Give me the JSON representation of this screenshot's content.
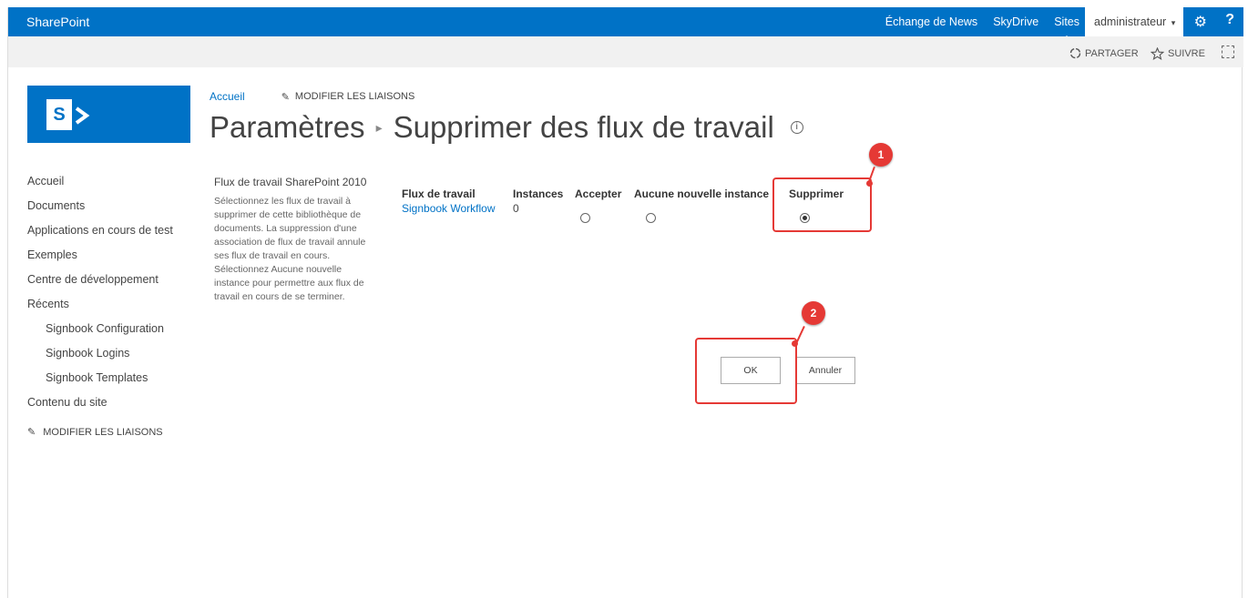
{
  "suitebar": {
    "brand": "SharePoint",
    "links": [
      "Échange de News",
      "SkyDrive",
      "Sites"
    ],
    "user": "administrateur",
    "help": "?",
    "accent": "#0072c6"
  },
  "ribbon": {
    "share": "PARTAGER",
    "follow": "SUIVRE"
  },
  "logo": {
    "letter": "S"
  },
  "topnav": {
    "home": "Accueil",
    "edit_links": "MODIFIER LES LIAISONS"
  },
  "title": {
    "parent": "Paramètres",
    "current": "Supprimer des flux de travail"
  },
  "leftnav": {
    "items": [
      "Accueil",
      "Documents",
      "Applications en cours de test",
      "Exemples",
      "Centre de développement",
      "Récents",
      "Signbook Configuration",
      "Signbook Logins",
      "Signbook Templates",
      "Contenu du site"
    ],
    "edit_links": "MODIFIER LES LIAISONS"
  },
  "section": {
    "title": "Flux de travail SharePoint 2010",
    "description": "Sélectionnez les flux de travail à supprimer de cette bibliothèque de documents. La suppression d'une association de flux de travail annule ses flux de travail en cours. Sélectionnez Aucune nouvelle instance pour permettre aux flux de travail en cours de se terminer."
  },
  "table": {
    "headers": [
      "Flux de travail",
      "Instances",
      "Accepter",
      "Aucune nouvelle instance",
      "Supprimer"
    ],
    "rows": [
      {
        "workflow": "Signbook Workflow",
        "instances": "0",
        "selected": "Supprimer"
      }
    ]
  },
  "buttons": {
    "ok": "OK",
    "cancel": "Annuler"
  },
  "annotations": {
    "badge1": "1",
    "badge2": "2",
    "color": "#e53935"
  }
}
